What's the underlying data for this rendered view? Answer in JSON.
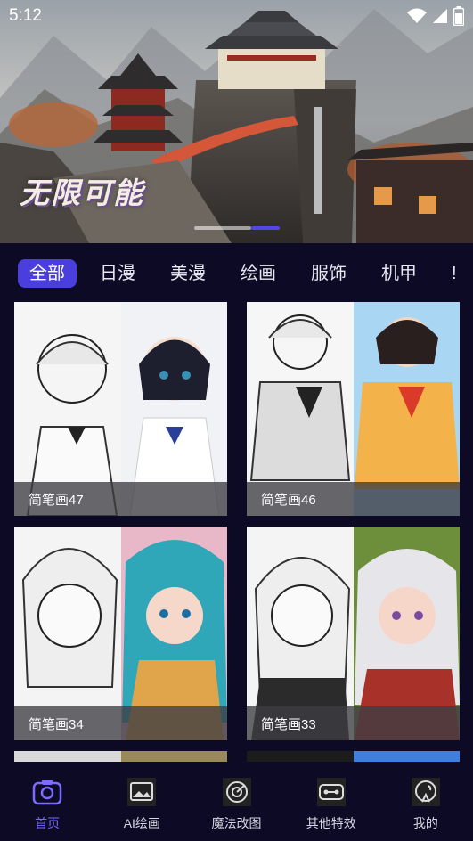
{
  "status_bar": {
    "time": "5:12",
    "icons": [
      "wifi-icon",
      "signal-icon",
      "battery-icon"
    ]
  },
  "banner": {
    "caption": "无限可能",
    "slide_count": 2,
    "active_slide": 2
  },
  "tabs": [
    {
      "label": "全部",
      "active": true
    },
    {
      "label": "日漫",
      "active": false
    },
    {
      "label": "美漫",
      "active": false
    },
    {
      "label": "绘画",
      "active": false
    },
    {
      "label": "服饰",
      "active": false
    },
    {
      "label": "机甲",
      "active": false
    },
    {
      "label": "!",
      "active": false
    }
  ],
  "cards": [
    {
      "label": "简笔画47"
    },
    {
      "label": "简笔画46"
    },
    {
      "label": "简笔画34"
    },
    {
      "label": "简笔画33"
    }
  ],
  "nav": [
    {
      "label": "首页",
      "icon": "camera-icon",
      "active": true
    },
    {
      "label": "AI绘画",
      "icon": "image-icon",
      "active": false
    },
    {
      "label": "魔法改图",
      "icon": "dial-icon",
      "active": false
    },
    {
      "label": "其他特效",
      "icon": "effects-icon",
      "active": false
    },
    {
      "label": "我的",
      "icon": "profile-icon",
      "active": false
    }
  ],
  "colors": {
    "background": "#0d0a26",
    "accent": "#4a3fdc",
    "nav_active": "#7b6cff"
  }
}
